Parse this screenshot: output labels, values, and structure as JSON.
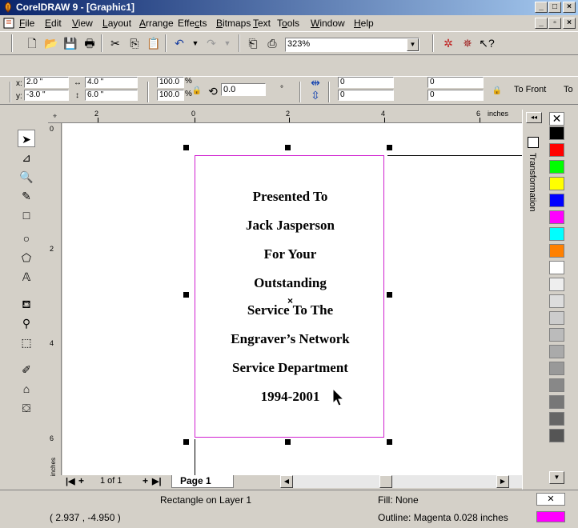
{
  "window": {
    "title": "CorelDRAW 9 - [Graphic1]"
  },
  "menu": [
    {
      "pre": "",
      "u": "F",
      "post": "ile"
    },
    {
      "pre": "",
      "u": "E",
      "post": "dit"
    },
    {
      "pre": "",
      "u": "V",
      "post": "iew"
    },
    {
      "pre": "",
      "u": "L",
      "post": "ayout"
    },
    {
      "pre": "",
      "u": "A",
      "post": "rrange"
    },
    {
      "pre": "Effe",
      "u": "c",
      "post": "ts"
    },
    {
      "pre": "",
      "u": "B",
      "post": "itmaps"
    },
    {
      "pre": "",
      "u": "T",
      "post": "ext"
    },
    {
      "pre": "T",
      "u": "o",
      "post": "ols"
    },
    {
      "pre": "",
      "u": "W",
      "post": "indow"
    },
    {
      "pre": "",
      "u": "H",
      "post": "elp"
    }
  ],
  "toolbar": {
    "zoom": "323%"
  },
  "property_bar": {
    "x_label": "x:",
    "x": "2.0 \"",
    "y_label": "y:",
    "y": "-3.0 \"",
    "w": "4.0 \"",
    "h": "6.0 \"",
    "scale_x": "100.0",
    "scale_y": "100.0",
    "pct": "%",
    "rotation": "0.0",
    "deg": "°",
    "corner1": "0",
    "corner2": "0",
    "corner3": "0",
    "corner4": "0",
    "to_front": "To Front",
    "to_back": "To"
  },
  "ruler": {
    "h_labels": [
      "2",
      "0",
      "2",
      "4",
      "6"
    ],
    "unit": "inches",
    "v_labels": [
      "0",
      "2",
      "4",
      "6"
    ],
    "v_unit": "inches"
  },
  "page_text": [
    "Presented To",
    "Jack Jasperson",
    "For Your",
    "Outstanding",
    "Service To The",
    "Engraver’s Network",
    "Service Department",
    "1994-2001"
  ],
  "page_nav": {
    "position": "1 of 1",
    "tab": "Page 1"
  },
  "docker": {
    "label": "Transformation"
  },
  "palette": [
    "#ffffff",
    "#000000",
    "#ff0000",
    "#00ff00",
    "#ffff00",
    "#0000ff",
    "#ff00ff",
    "#00ffff",
    "#ff8000",
    "#ffffff",
    "#eeeeee",
    "#dddddd",
    "#cccccc",
    "#bbbbbb",
    "#aaaaaa",
    "#999999",
    "#888888",
    "#777777",
    "#666666",
    "#555555"
  ],
  "status": {
    "object": "Rectangle on Layer 1",
    "coords": "( 2.937 , -4.950 )",
    "fill": "Fill: None",
    "outline": "Outline: Magenta  0.028 inches",
    "outline_color": "#ff00ff"
  }
}
